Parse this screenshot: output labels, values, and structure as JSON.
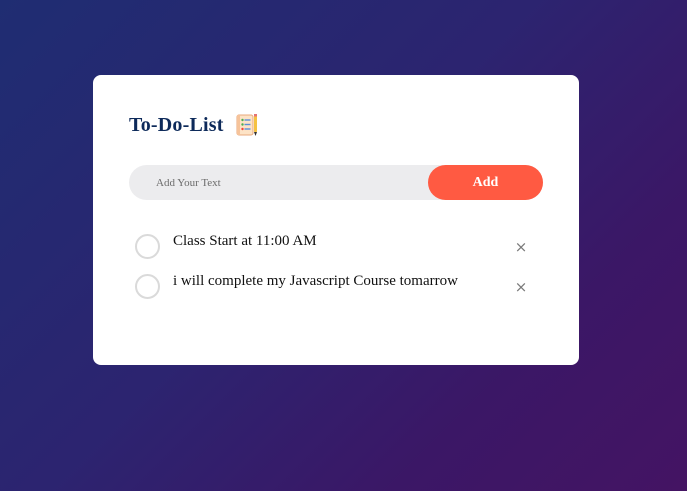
{
  "app": {
    "title": "To-Do-List",
    "title_icon": "notepad-checklist-icon"
  },
  "input": {
    "placeholder": "Add Your Text",
    "value": "",
    "add_label": "Add"
  },
  "tasks": [
    {
      "text": "Class Start at 11:00 AM",
      "checked": false,
      "delete_icon": "close-icon",
      "delete_glyph": "×"
    },
    {
      "text": "i will complete my Javascript Course tomarrow",
      "checked": false,
      "delete_icon": "close-icon",
      "delete_glyph": "×"
    }
  ],
  "colors": {
    "accent": "#ff5a42",
    "title": "#0d2a5a",
    "input_bg": "#ececee",
    "background_start": "#1f2d72",
    "background_end": "#441463"
  }
}
